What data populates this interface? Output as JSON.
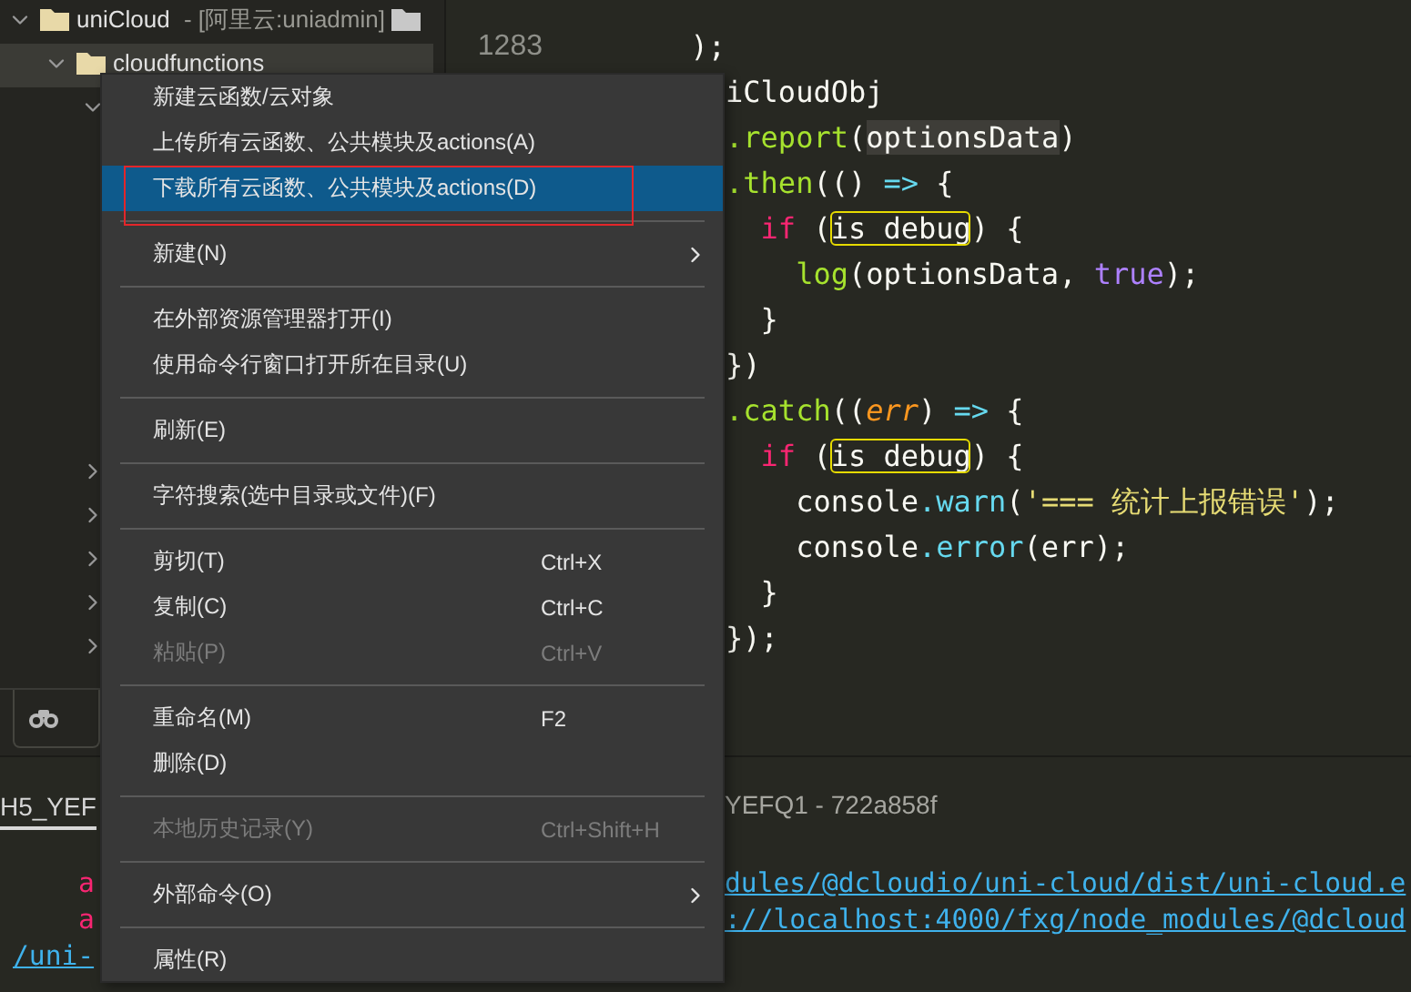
{
  "sidebar": {
    "tree": [
      {
        "label": "uniCloud",
        "suffix": " - [阿里云:uniadmin]",
        "expanded": true,
        "selected": false,
        "children": [
          {
            "label": "cloudfunctions",
            "expanded": true,
            "selected": true,
            "children": [
              {
                "expanded": true,
                "selected": false
              },
              {
                "expanded": false,
                "selected": false
              },
              {
                "expanded": false,
                "selected": false
              },
              {
                "expanded": false,
                "selected": false
              },
              {
                "expanded": false,
                "selected": false
              },
              {
                "expanded": false,
                "selected": false
              }
            ]
          }
        ]
      }
    ]
  },
  "editor": {
    "line_numbers": [
      "1283"
    ],
    "lines": [
      [
        {
          "text": "  );",
          "kind": "plain"
        }
      ],
      [
        {
          "text": "    iCloudObj",
          "kind": "plain"
        }
      ],
      [
        {
          "text": "    .report",
          "kind": "method"
        },
        {
          "text": "(",
          "kind": "plain"
        },
        {
          "text": "optionsData",
          "kind": "marked"
        },
        {
          "text": ")",
          "kind": "plain"
        }
      ],
      [
        {
          "text": "    .then",
          "kind": "method"
        },
        {
          "text": "(() ",
          "kind": "plain"
        },
        {
          "text": "=>",
          "kind": "operator"
        },
        {
          "text": " {",
          "kind": "plain"
        }
      ],
      [
        {
          "text": "      if",
          "kind": "keyword"
        },
        {
          "text": " (",
          "kind": "plain"
        },
        {
          "text": "is_debug",
          "kind": "boxed"
        },
        {
          "text": ") {",
          "kind": "plain"
        }
      ],
      [
        {
          "text": "        log",
          "kind": "method"
        },
        {
          "text": "(optionsData, ",
          "kind": "plain"
        },
        {
          "text": "true",
          "kind": "boolean"
        },
        {
          "text": ");",
          "kind": "plain"
        }
      ],
      [
        {
          "text": "      }",
          "kind": "plain"
        }
      ],
      [
        {
          "text": "    })",
          "kind": "plain"
        }
      ],
      [
        {
          "text": "    .catch",
          "kind": "method"
        },
        {
          "text": "((",
          "kind": "plain"
        },
        {
          "text": "err",
          "kind": "param"
        },
        {
          "text": ") ",
          "kind": "plain"
        },
        {
          "text": "=>",
          "kind": "operator"
        },
        {
          "text": " {",
          "kind": "plain"
        }
      ],
      [
        {
          "text": "      if",
          "kind": "keyword"
        },
        {
          "text": " (",
          "kind": "plain"
        },
        {
          "text": "is_debug",
          "kind": "boxed"
        },
        {
          "text": ") {",
          "kind": "plain"
        }
      ],
      [
        {
          "text": "        console",
          "kind": "plain"
        },
        {
          "text": ".warn",
          "kind": "operator"
        },
        {
          "text": "(",
          "kind": "plain"
        },
        {
          "text": "'=== 统计上报错误'",
          "kind": "string"
        },
        {
          "text": ");",
          "kind": "plain"
        }
      ],
      [
        {
          "text": "        console",
          "kind": "plain"
        },
        {
          "text": ".error",
          "kind": "operator"
        },
        {
          "text": "(err);",
          "kind": "plain"
        }
      ],
      [
        {
          "text": "      }",
          "kind": "plain"
        }
      ],
      [
        {
          "text": "    });",
          "kind": "plain"
        }
      ]
    ]
  },
  "console": {
    "rows": [
      {
        "kind": "header",
        "left": "H5_YEF",
        "right": "YEFQ1 - 722a858f",
        "selected": true
      },
      {
        "kind": "gap"
      },
      {
        "kind": "trace",
        "left": "a",
        "right": "dules/@dcloudio/uni-cloud/dist/uni-cloud.e"
      },
      {
        "kind": "trace",
        "left": "a",
        "right": "://localhost:4000/fxg/node_modules/@dcloud"
      },
      {
        "kind": "link",
        "left": "/uni-"
      }
    ]
  },
  "context_menu": {
    "items": [
      {
        "kind": "item",
        "label": "新建云函数/云对象",
        "selected": false,
        "disabled": false
      },
      {
        "kind": "item",
        "label": "上传所有云函数、公共模块及actions(A)",
        "selected": false,
        "disabled": false
      },
      {
        "kind": "item",
        "label": "下载所有云函数、公共模块及actions(D)",
        "selected": true,
        "disabled": false
      },
      {
        "kind": "separator"
      },
      {
        "kind": "item",
        "label": "新建(N)",
        "selected": false,
        "disabled": false,
        "submenu": true
      },
      {
        "kind": "separator"
      },
      {
        "kind": "item",
        "label": "在外部资源管理器打开(I)",
        "selected": false,
        "disabled": false
      },
      {
        "kind": "item",
        "label": "使用命令行窗口打开所在目录(U)",
        "selected": false,
        "disabled": false
      },
      {
        "kind": "separator"
      },
      {
        "kind": "item",
        "label": "刷新(E)",
        "selected": false,
        "disabled": false
      },
      {
        "kind": "separator"
      },
      {
        "kind": "item",
        "label": "字符搜索(选中目录或文件)(F)",
        "selected": false,
        "disabled": false
      },
      {
        "kind": "separator"
      },
      {
        "kind": "item",
        "label": "剪切(T)",
        "shortcut": "Ctrl+X",
        "selected": false,
        "disabled": false
      },
      {
        "kind": "item",
        "label": "复制(C)",
        "shortcut": "Ctrl+C",
        "selected": false,
        "disabled": false
      },
      {
        "kind": "item",
        "label": "粘贴(P)",
        "shortcut": "Ctrl+V",
        "selected": false,
        "disabled": true
      },
      {
        "kind": "separator"
      },
      {
        "kind": "item",
        "label": "重命名(M)",
        "shortcut": "F2",
        "selected": false,
        "disabled": false
      },
      {
        "kind": "item",
        "label": "删除(D)",
        "selected": false,
        "disabled": false
      },
      {
        "kind": "separator"
      },
      {
        "kind": "item",
        "label": "本地历史记录(Y)",
        "shortcut": "Ctrl+Shift+H",
        "selected": false,
        "disabled": true
      },
      {
        "kind": "separator"
      },
      {
        "kind": "item",
        "label": "外部命令(O)",
        "selected": false,
        "disabled": false,
        "submenu": true
      },
      {
        "kind": "separator"
      },
      {
        "kind": "item",
        "label": "属性(R)",
        "selected": false,
        "disabled": false
      }
    ]
  }
}
